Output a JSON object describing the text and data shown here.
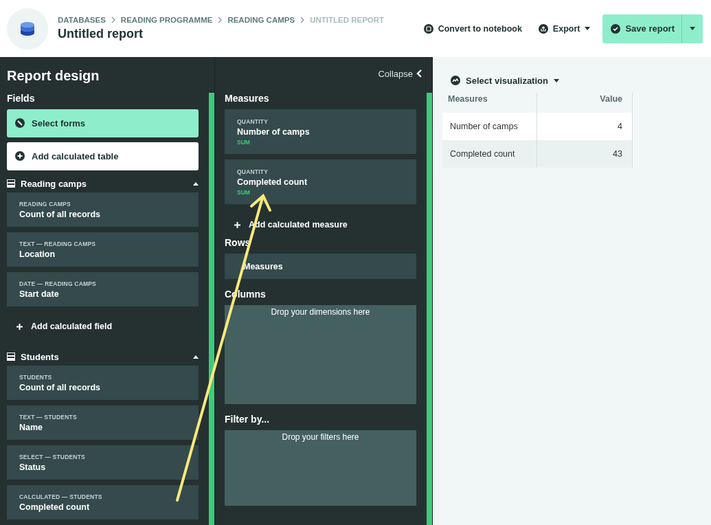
{
  "header": {
    "breadcrumbs": [
      {
        "label": "DATABASES",
        "current": false
      },
      {
        "label": "READING PROGRAMME",
        "current": false
      },
      {
        "label": "READING CAMPS",
        "current": false
      },
      {
        "label": "UNTITLED REPORT",
        "current": true
      }
    ],
    "title": "Untitled report",
    "actions": [
      {
        "kind": "notebook",
        "label": "Convert to notebook"
      },
      {
        "kind": "export",
        "label": "Export"
      }
    ],
    "save_button": {
      "label": "Save report"
    }
  },
  "report_design": {
    "title": "Report design",
    "fields_heading": "Fields",
    "select_forms": "Select forms",
    "add_table": "Add calculated table",
    "sections": [
      {
        "title": "Reading camps",
        "expanded": true,
        "fields": [
          {
            "type": "READING CAMPS",
            "name": "Count of all records"
          },
          {
            "type": "TEXT — READING CAMPS",
            "name": "Location"
          },
          {
            "type": "DATE — READING CAMPS",
            "name": "Start date"
          }
        ],
        "add_field": "Add calculated field"
      },
      {
        "title": "Students",
        "expanded": true,
        "fields": [
          {
            "type": "STUDENTS",
            "name": "Count of all records"
          },
          {
            "type": "TEXT — STUDENTS",
            "name": "Name"
          },
          {
            "type": "SELECT — STUDENTS",
            "name": "Status"
          },
          {
            "type": "CALCULATED — STUDENTS",
            "name": "Completed count"
          }
        ]
      }
    ]
  },
  "layout_panel": {
    "collapse": "Collapse",
    "measures_heading": "Measures",
    "measures": [
      {
        "type": "QUANTITY",
        "name": "Number of camps",
        "aggregation": "SUM"
      },
      {
        "type": "QUANTITY",
        "name": "Completed count",
        "aggregation": "SUM"
      }
    ],
    "add_measure": "Add calculated measure",
    "rows_heading": "Rows",
    "rows": [
      "Measures"
    ],
    "columns_heading": "Columns",
    "columns_placeholder": "Drop your dimensions here",
    "filter_heading": "Filter by...",
    "filter_placeholder": "Drop your filters here"
  },
  "preview": {
    "visualization": "Select visualization",
    "table": {
      "columns": [
        "Measures",
        "Value"
      ],
      "rows": [
        [
          "Number of camps",
          "4"
        ],
        [
          "Completed count",
          "43"
        ]
      ]
    }
  }
}
